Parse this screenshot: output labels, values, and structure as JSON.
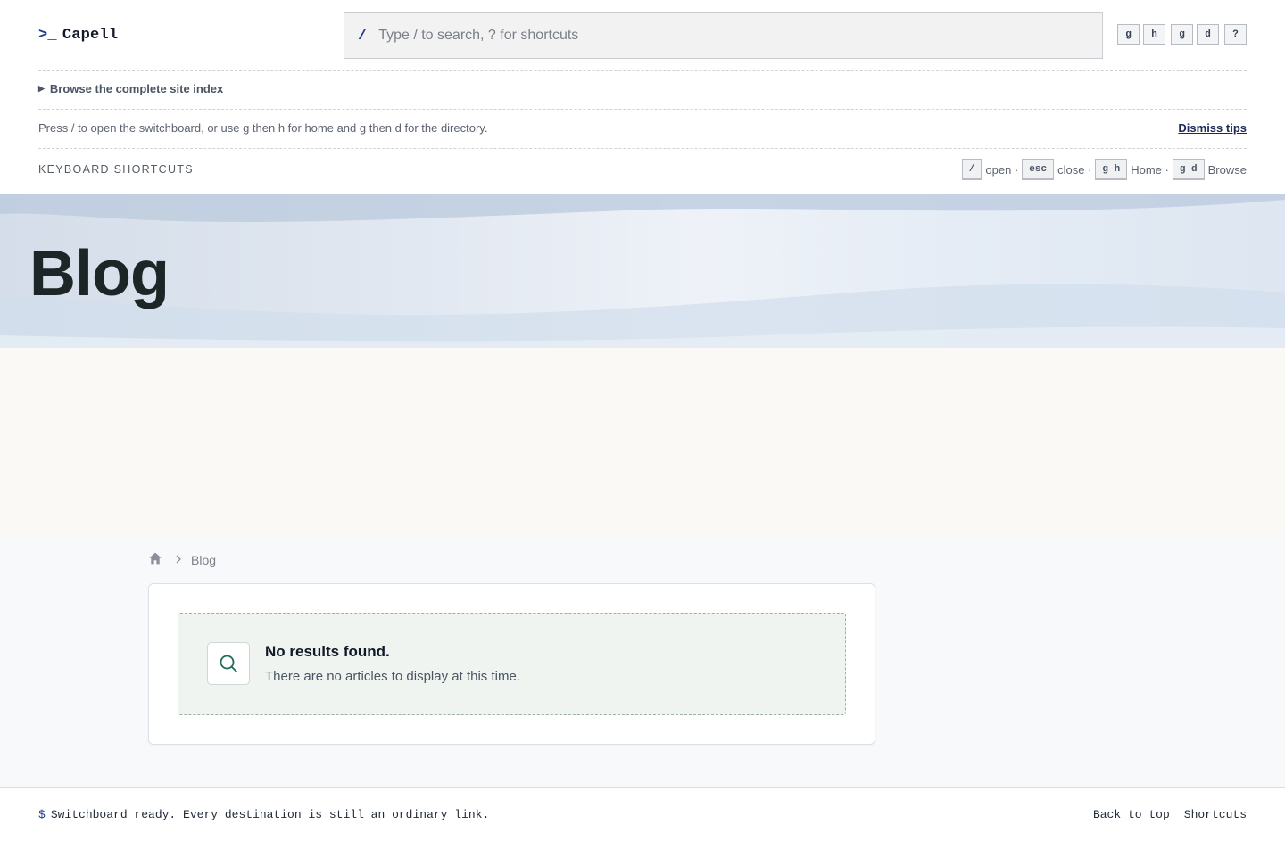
{
  "header": {
    "logo_prompt": ">_",
    "logo_text": "Capell",
    "search_slash": "/",
    "search_placeholder": "Type / to search, ? for shortcuts",
    "keys": [
      "g",
      "h",
      "g",
      "d",
      "?"
    ],
    "site_index": "Browse the complete site index",
    "tip": "Press / to open the switchboard, or use g then h for home and g then d for the directory.",
    "dismiss": "Dismiss tips",
    "shortcuts_title": "KEYBOARD SHORTCUTS",
    "legend": [
      {
        "key": "/",
        "label": "open ·"
      },
      {
        "key": "esc",
        "label": "close ·"
      },
      {
        "key": "g h",
        "label": "Home ·"
      },
      {
        "key": "g d",
        "label": "Browse"
      }
    ]
  },
  "hero": {
    "title": "Blog"
  },
  "breadcrumb": {
    "current": "Blog"
  },
  "empty_state": {
    "title": "No results found.",
    "description": "There are no articles to display at this time."
  },
  "footer": {
    "prompt": "$",
    "status": "Switchboard ready. Every destination is still an ordinary link.",
    "back_to_top": "Back to top",
    "shortcuts": "Shortcuts"
  },
  "colors": {
    "accent": "#1e3a8a",
    "empty_bg": "#eff4f0",
    "icon_stroke": "#1f6b5a"
  }
}
